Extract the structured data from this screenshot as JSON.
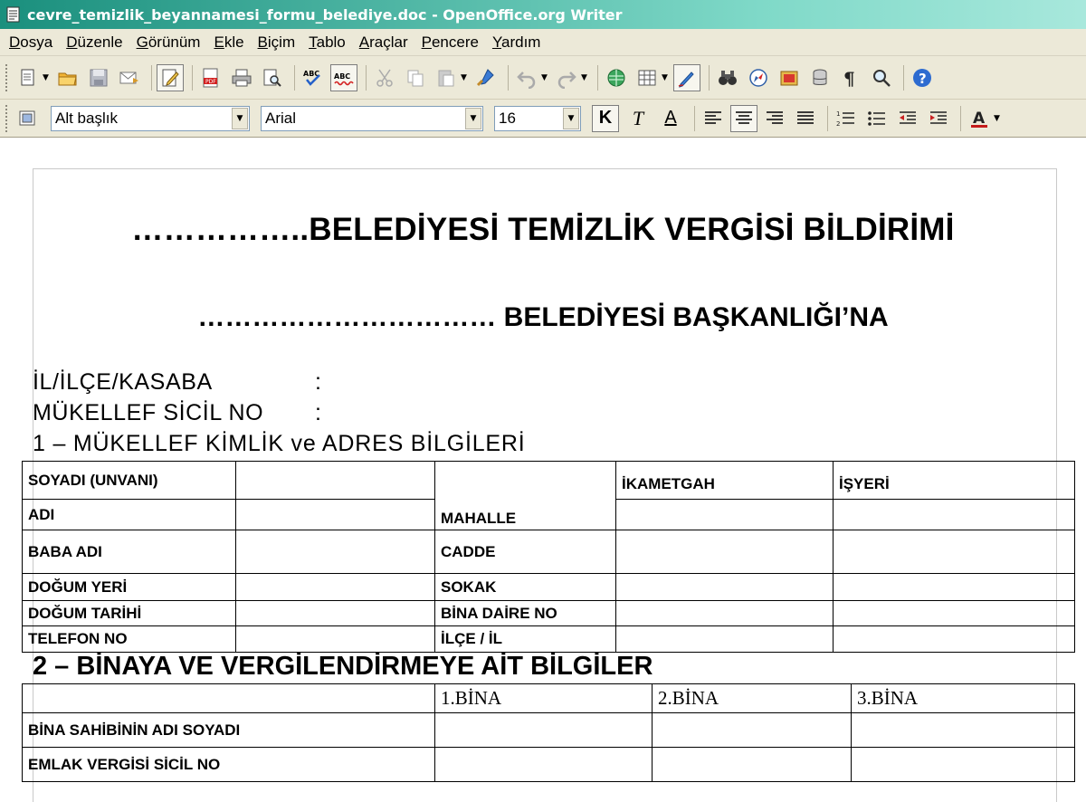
{
  "window": {
    "title": "cevre_temizlik_beyannamesi_formu_belediye.doc - OpenOffice.org Writer"
  },
  "menu": [
    {
      "label": "Dosya",
      "ul": "D",
      "rest": "osya"
    },
    {
      "label": "Düzenle",
      "ul": "D",
      "rest": "üzenle"
    },
    {
      "label": "Görünüm",
      "ul": "G",
      "rest": "örünüm"
    },
    {
      "label": "Ekle",
      "ul": "E",
      "rest": "kle"
    },
    {
      "label": "Biçim",
      "ul": "B",
      "rest": "içim"
    },
    {
      "label": "Tablo",
      "ul": "T",
      "rest": "ablo"
    },
    {
      "label": "Araçlar",
      "ul": "A",
      "rest": "raçlar"
    },
    {
      "label": "Pencere",
      "ul": "P",
      "rest": "encere"
    },
    {
      "label": "Yardım",
      "ul": "Y",
      "rest": "ardım"
    }
  ],
  "format_toolbar": {
    "paragraph_style": "Alt başlık",
    "font_name": "Arial",
    "font_size": "16",
    "bold_label": "K",
    "italic_label": "T",
    "underline_label": "A"
  },
  "document": {
    "heading": "……………..BELEDİYESİ TEMİZLİK VERGİSİ BİLDİRİMİ",
    "addressee": "…………………………… BELEDİYESİ BAŞKANLIĞI’NA",
    "field_city": "İL/İLÇE/KASABA",
    "field_registry": "MÜKELLEF SİCİL NO",
    "colon": ":",
    "section1_title": "1 – MÜKELLEF KİMLİK ve ADRES BİLGİLERİ",
    "section2_title": "2 – BİNAYA VE VERGİLENDİRMEYE AİT BİLGİLER",
    "table1": {
      "left_labels": [
        "SOYADI (UNVANI)",
        "ADI",
        "BABA ADI",
        "DOĞUM YERİ",
        "DOĞUM TARİHİ",
        "TELEFON NO"
      ],
      "right_labels": [
        "MAHALLE",
        "CADDE",
        "SOKAK",
        "BİNA DAİRE NO",
        "İLÇE / İL"
      ],
      "col_residence": "İKAMETGAH",
      "col_business": "İŞYERİ"
    },
    "table2": {
      "headers": [
        "1.BİNA",
        "2.BİNA",
        "3.BİNA"
      ],
      "rows": [
        "BİNA SAHİBİNİN ADI SOYADI",
        "EMLAK VERGİSİ SİCİL NO"
      ]
    }
  }
}
